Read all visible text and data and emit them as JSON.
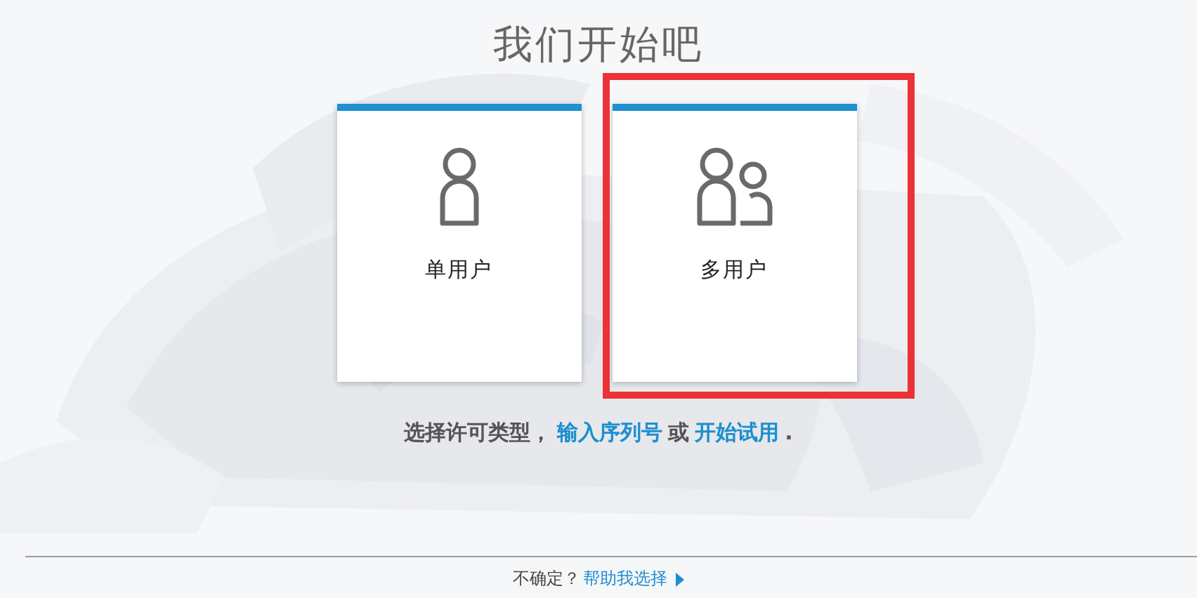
{
  "title": "我们开始吧",
  "options": [
    {
      "kind": "single",
      "label": "单用户",
      "highlighted": false
    },
    {
      "kind": "multi",
      "label": "多用户",
      "highlighted": true
    }
  ],
  "prompt": [
    {
      "kind": "text",
      "text": "选择许可类型，"
    },
    {
      "kind": "link",
      "text": "输入序列号"
    },
    {
      "kind": "text",
      "text": "或"
    },
    {
      "kind": "link",
      "text": "开始试用"
    },
    {
      "kind": "text",
      "text": "."
    }
  ],
  "footer": {
    "question": "不确定？",
    "link": "帮助我选择"
  }
}
